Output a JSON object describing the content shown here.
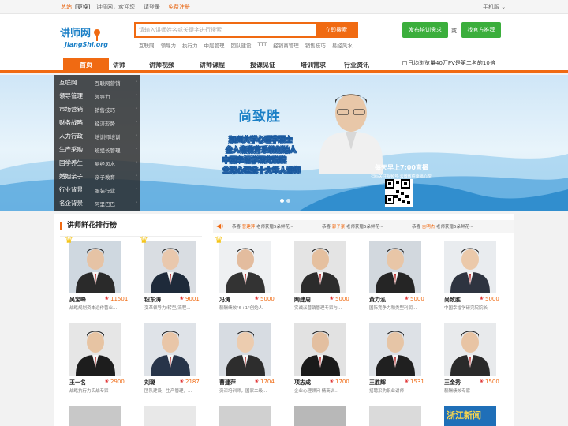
{
  "topbar": {
    "city": "总站",
    "change": "[更换]",
    "welcome": "讲师网，欢迎您",
    "login": "请登录",
    "register": "免费注册",
    "mobile": "手机版"
  },
  "header": {
    "logo_text": "讲师网",
    "logo_sub": "JiangShi.org",
    "search_placeholder": "请输入讲师姓名或关键字进行搜索",
    "search_button": "立即搜索",
    "hotwords": [
      "互联网",
      "领导力",
      "执行力",
      "中层管理",
      "团队建设",
      "TTT",
      "经销商管理",
      "销售技巧",
      "易经风水"
    ],
    "post_button": "发布培训需求",
    "or_text": "或",
    "find_button": "找官方推荐"
  },
  "nav": {
    "items": [
      "首页",
      "讲师",
      "讲师视频",
      "讲师课程",
      "授课见证",
      "培训需求",
      "行业资讯"
    ],
    "banner_alt": "日均浏览量40万PV是第二名的10倍"
  },
  "categories": [
    {
      "main": "互联网",
      "sub": "互联网营销"
    },
    {
      "main": "领导管理",
      "sub": "领导力"
    },
    {
      "main": "市场营销",
      "sub": "销售技巧"
    },
    {
      "main": "财务战略",
      "sub": "经济形势"
    },
    {
      "main": "人力行政",
      "sub": "培训师培训"
    },
    {
      "main": "生产采购",
      "sub": "班组长管理"
    },
    {
      "main": "国学养生",
      "sub": "易经风水"
    },
    {
      "main": "婚姻亲子",
      "sub": "亲子教育"
    },
    {
      "main": "行业背景",
      "sub": "服装行业"
    },
    {
      "main": "名企背景",
      "sub": "阿里巴巴"
    }
  ],
  "banner": {
    "name": "尚致胜",
    "lines": [
      "加州大学心理学硕士",
      "全人格教育系统创始人",
      "中国幸福学研究院院",
      "全球心理类十大华人讲师"
    ],
    "live": "每天早上7:00直播",
    "scan": "扫码关注视频号·云微致胜幸福心理"
  },
  "ranking": {
    "title": "讲师鲜花排行榜",
    "notices": [
      {
        "pre": "恭喜",
        "name": "曹建萍",
        "post": "老师获赠5朵鲜花~"
      },
      {
        "pre": "恭喜",
        "name": "郭子豪",
        "post": "老师获赠5朵鲜花~"
      },
      {
        "pre": "恭喜",
        "name": "吉明杰",
        "post": "老师获赠5朵鲜花~"
      }
    ],
    "teachers": [
      {
        "name": "吴宝峰",
        "count": "11501",
        "desc": "战略规划资本运作营业..."
      },
      {
        "name": "钮东涛",
        "count": "9001",
        "desc": "变革领导力/转型/流程..."
      },
      {
        "name": "冯涛",
        "count": "5000",
        "desc": "薪酬绩效\"6+1\"创始人"
      },
      {
        "name": "陶建周",
        "count": "5000",
        "desc": "实战派营销管理专家与..."
      },
      {
        "name": "黄力泓",
        "count": "5000",
        "desc": "国际竞争力和类型利润..."
      },
      {
        "name": "尚致胜",
        "count": "5000",
        "desc": "中国幸福学研究院院长"
      },
      {
        "name": "王一名",
        "count": "2900",
        "desc": "战略执行力实战专家"
      },
      {
        "name": "刘璐",
        "count": "2187",
        "desc": "团队建设，生产管理，..."
      },
      {
        "name": "曹建萍",
        "count": "1704",
        "desc": "资深培训师，国家二级..."
      },
      {
        "name": "项志成",
        "count": "1700",
        "desc": "企业心理顾问 情商训..."
      },
      {
        "name": "王胜辉",
        "count": "1531",
        "desc": "招聘采购职业讲师"
      },
      {
        "name": "王金秀",
        "count": "1500",
        "desc": "薪酬绩效专家"
      }
    ],
    "partial_tile": "浙江新闻"
  }
}
